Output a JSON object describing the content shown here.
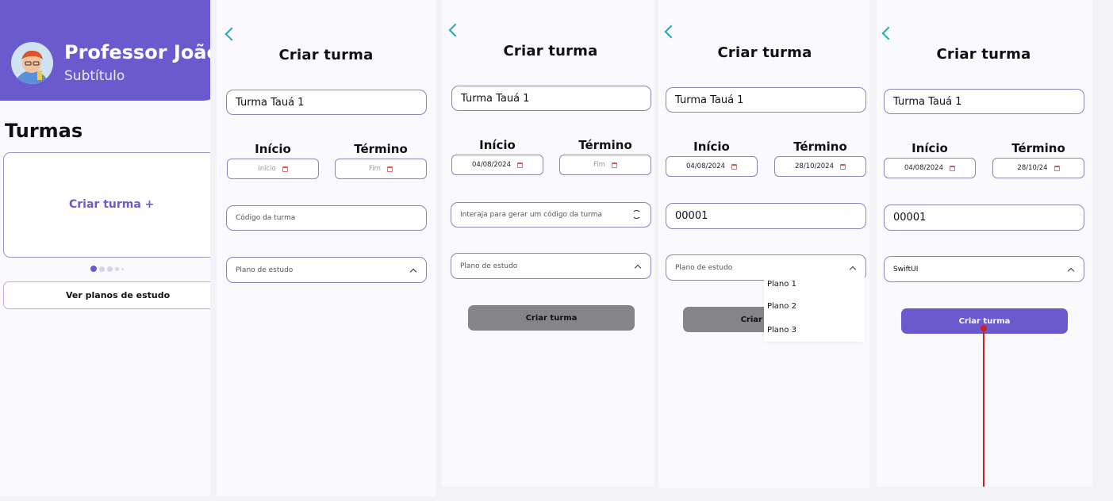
{
  "home": {
    "header_title": "Professor João",
    "header_subtitle": "Subtítulo",
    "section_title": "Turmas",
    "create_card_label": "Criar turma +",
    "study_plans_button": "Ver planos de estudo"
  },
  "screens": [
    {
      "title": "Criar turma",
      "class_name": "Turma Tauá 1",
      "start_label": "Início",
      "end_label": "Término",
      "start_value": "Início",
      "end_value": "Fim",
      "code_value": "Código da turma",
      "plan_value": "Plano de estudo"
    },
    {
      "title": "Criar turma",
      "class_name": "Turma Tauá 1",
      "start_label": "Início",
      "end_label": "Término",
      "start_value": "04/08/2024",
      "end_value": "Fim",
      "code_value": "Interaja para gerar um código da turma",
      "plan_value": "Plano de estudo",
      "submit_label": "Criar turma"
    },
    {
      "title": "Criar turma",
      "class_name": "Turma Tauá 1",
      "start_label": "Início",
      "end_label": "Término",
      "start_value": "04/08/2024",
      "end_value": "28/10/2024",
      "code_value": "00001",
      "plan_value": "Plano de estudo",
      "submit_label": "Criar turma",
      "plan_options": [
        "Plano 1",
        "Plano 2",
        "Plano 3"
      ]
    },
    {
      "title": "Criar turma",
      "class_name": "Turma Tauá 1",
      "start_label": "Início",
      "end_label": "Término",
      "start_value": "04/08/2024",
      "end_value": "28/10/24",
      "code_value": "00001",
      "plan_value": "SwiftUI",
      "submit_label": "Criar turma"
    }
  ],
  "colors": {
    "accent": "#6a5acd",
    "back_arrow": "#22a5b8",
    "disabled_button": "#858489",
    "connector": "#cc2222"
  },
  "icons": [
    "back-arrow-icon",
    "calendar-icon",
    "refresh-icon",
    "chevron-up-icon",
    "avatar"
  ]
}
